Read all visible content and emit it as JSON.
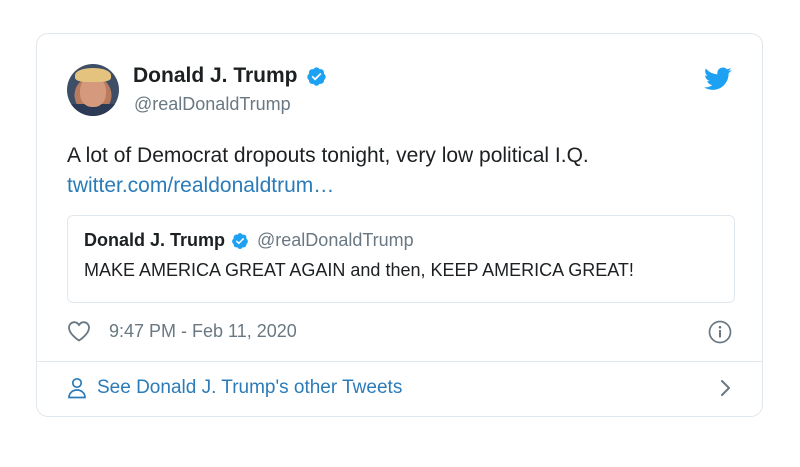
{
  "tweet": {
    "author_name": "Donald J. Trump",
    "author_handle": "@realDonaldTrump",
    "text": "A lot of Democrat dropouts tonight, very low political I.Q.",
    "link": "twitter.com/realdonaldtrum…",
    "timestamp": "9:47 PM - Feb 11, 2020"
  },
  "quoted_tweet": {
    "author_name": "Donald J. Trump",
    "author_handle": "@realDonaldTrump",
    "text": "MAKE AMERICA GREAT AGAIN and then, KEEP AMERICA GREAT!"
  },
  "footer": {
    "see_more_label": "See Donald J. Trump's other Tweets"
  },
  "icons": {
    "verified": "verified-badge-icon",
    "brand": "twitter-bird-icon",
    "like": "heart-icon",
    "info": "info-icon",
    "person": "person-icon",
    "chevron": "chevron-right-icon"
  },
  "colors": {
    "link": "#2b7bb9",
    "verified": "#1da1f2",
    "muted": "#697882",
    "border": "#e1e8ed"
  }
}
